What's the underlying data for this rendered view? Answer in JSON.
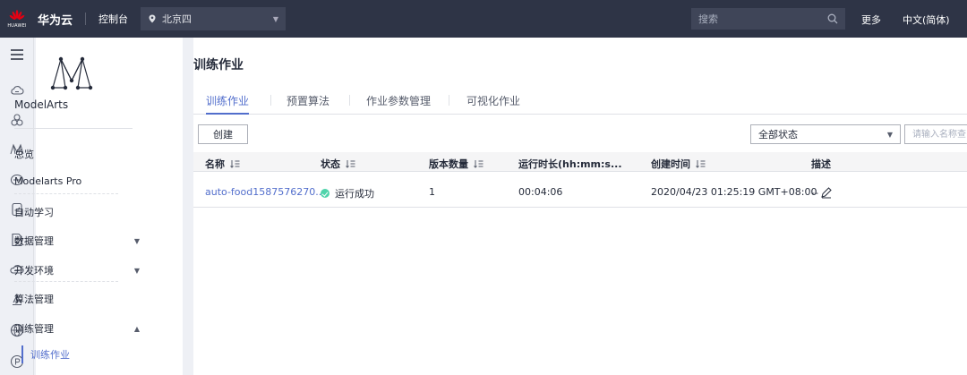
{
  "header": {
    "brand_small": "HUAWEI",
    "brand": "华为云",
    "console": "控制台",
    "region": "北京四",
    "search_placeholder": "搜索",
    "more": "更多",
    "language": "中文(简体)"
  },
  "icon_rail": [
    "cloud-icon",
    "cluster-icon",
    "modelarts-icon",
    "database-icon",
    "document-icon",
    "file-icon",
    "cloud-service-icon",
    "alert-icon",
    "globe-icon",
    "circle-p-icon"
  ],
  "sidebar": {
    "product": "ModelArts",
    "items": [
      {
        "label": "总览"
      },
      {
        "label": "Modelarts Pro"
      },
      {
        "label": "自动学习"
      },
      {
        "label": "数据管理",
        "caret": "▼"
      },
      {
        "label": "开发环境",
        "caret": "▼"
      },
      {
        "label": "算法管理"
      },
      {
        "label": "训练管理",
        "caret": "▲"
      }
    ],
    "sub_item": "训练作业"
  },
  "main": {
    "title": "训练作业",
    "tabs": [
      {
        "label": "训练作业"
      },
      {
        "label": "预置算法"
      },
      {
        "label": "作业参数管理"
      },
      {
        "label": "可视化作业"
      }
    ],
    "create_button": "创建",
    "status_filter": "全部状态",
    "name_search_placeholder": "请输入名称查",
    "table": {
      "columns": [
        "名称",
        "状态",
        "版本数量",
        "运行时长(hh:mm:s...",
        "创建时间",
        "描述"
      ],
      "rows": [
        {
          "name": "auto-food1587576270...",
          "status": "运行成功",
          "versions": "1",
          "duration": "00:04:06",
          "created": "2020/04/23 01:25:19 GMT+08:00",
          "description": "--"
        }
      ]
    }
  },
  "colors": {
    "topbar": "#2e3446",
    "accent": "#526ecc",
    "success": "#50d4ab"
  }
}
